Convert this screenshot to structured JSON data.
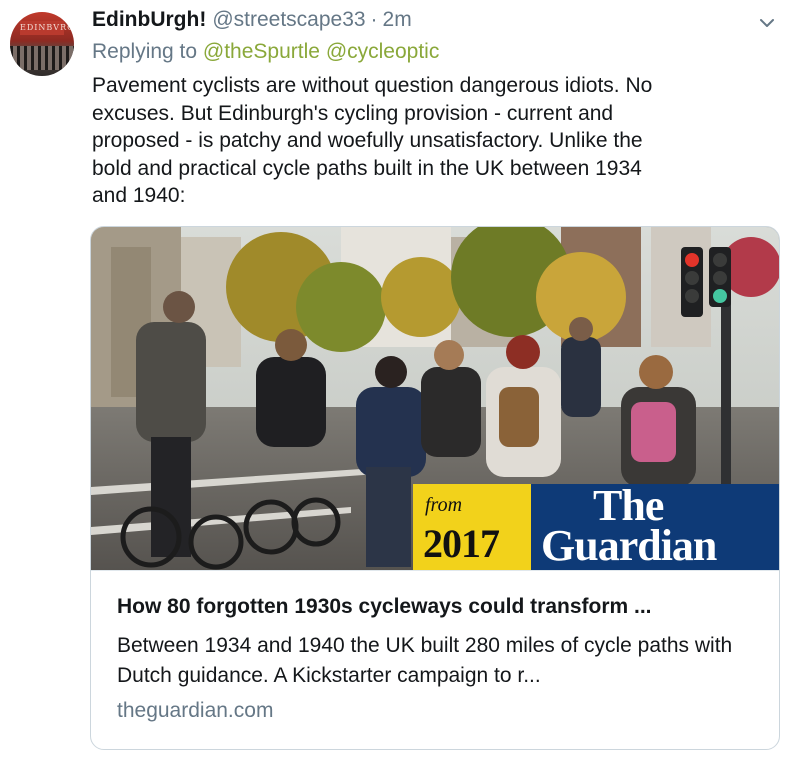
{
  "tweet": {
    "display_name": "EdinbUrgh!",
    "handle": "@streetscape33",
    "separator": "·",
    "time": "2m",
    "avatar_sign": "EDINBVRG",
    "reply": {
      "prefix": "Replying to",
      "mentions": [
        "@theSpurtle",
        "@cycleoptic"
      ]
    },
    "text": "Pavement cyclists are without question dangerous idiots. No\nexcuses. But Edinburgh's cycling provision - current and\nproposed - is patchy and woefully unsatisfactory. Unlike the\nbold and practical cycle paths built in the UK between 1934\nand 1940:",
    "caret_icon": "chevron-down-icon"
  },
  "card": {
    "badge": {
      "from": "from",
      "year": "2017",
      "brand_line1": "The",
      "brand_line2": "Guardian",
      "year_bg": "#f2d21b",
      "brand_bg": "#0e3a77"
    },
    "title": "How 80 forgotten 1930s cycleways could transform ...",
    "description": "Between 1934 and 1940 the UK built 280 miles of cycle paths with Dutch guidance. A Kickstarter campaign to r...",
    "domain": "theguardian.com"
  },
  "colors": {
    "text": "#14171a",
    "muted": "#657786",
    "mention": "#8aa83a",
    "border": "#ccd6dd"
  }
}
